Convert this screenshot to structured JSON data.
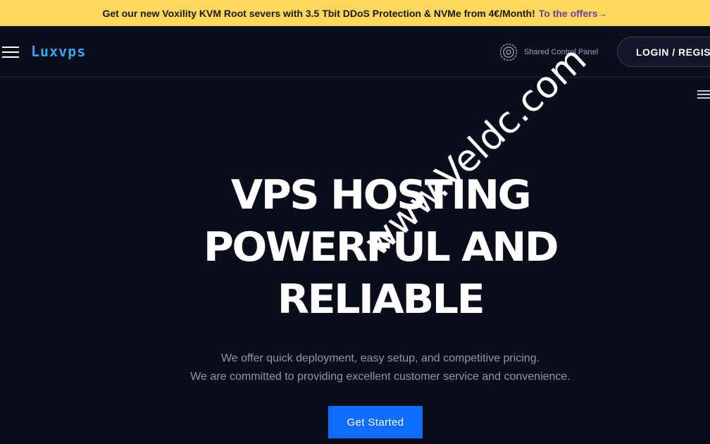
{
  "promo": {
    "text": "Get our new Voxility KVM Root severs with 3.5 Tbit DDoS Protection & NVMe from 4€/Month!",
    "link_label": "To the offers→"
  },
  "header": {
    "logo": "Luxvps",
    "control_panel_label": "Shared Control Panel",
    "login_label": "LOGIN / REGISTER",
    "icons": [
      "hamburger-icon",
      "gear-icon",
      "menu-icon"
    ]
  },
  "hero": {
    "title_lines": [
      "VPS HOSTING",
      "POWERFUL AND",
      "RELIABLE"
    ],
    "subtitle_lines": [
      "We offer quick deployment, easy setup, and competitive pricing.",
      "We are committed to providing excellent customer service and convenience."
    ],
    "cta_label": "Get Started"
  },
  "watermark": "www.Veldc.com",
  "colors": {
    "background": "#0b0d1a",
    "promo_bg": "#fbd75b",
    "promo_link": "#6b3fa0",
    "logo": "#37a6f2",
    "cta": "#0d6efd"
  }
}
